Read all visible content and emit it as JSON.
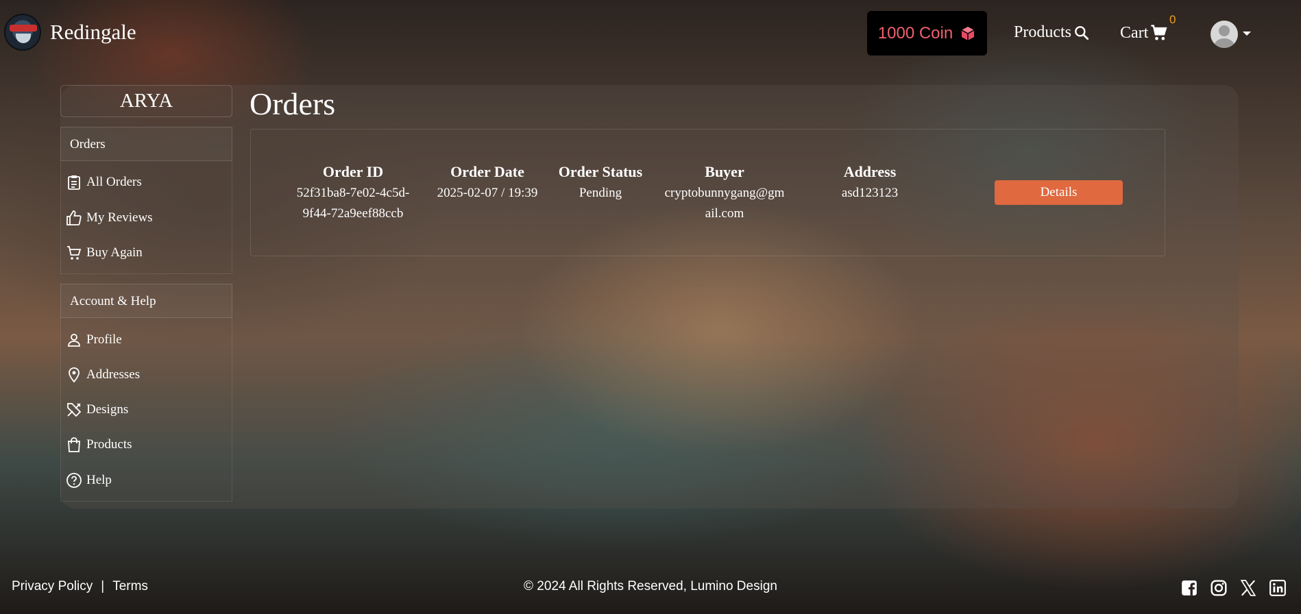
{
  "navbar": {
    "brand": "Redingale",
    "coin_label": "1000 Coin",
    "products_label": "Products",
    "cart_label": "Cart",
    "cart_count": "0"
  },
  "sidebar": {
    "user_name": "ARYA",
    "orders_section": "Orders",
    "orders_items": [
      {
        "label": "All Orders",
        "icon": "clipboard-icon"
      },
      {
        "label": "My Reviews",
        "icon": "thumbs-up-icon"
      },
      {
        "label": "Buy Again",
        "icon": "cart-icon"
      }
    ],
    "account_section": "Account & Help",
    "account_items": [
      {
        "label": "Profile",
        "icon": "person-icon"
      },
      {
        "label": "Addresses",
        "icon": "location-pin-icon"
      },
      {
        "label": "Designs",
        "icon": "design-tools-icon"
      },
      {
        "label": "Products",
        "icon": "shopping-bag-icon"
      },
      {
        "label": "Help",
        "icon": "help-circle-icon"
      }
    ]
  },
  "main": {
    "title": "Orders",
    "columns": [
      "Order ID",
      "Order Date",
      "Order Status",
      "Buyer",
      "Address"
    ],
    "order": {
      "id_line1": "52f31ba8-7e02-4c5d-",
      "id_line2": "9f44-72a9eef88ccb",
      "date": "2025-02-07 / 19:39",
      "status": "Pending",
      "buyer_line1": "cryptobunnygang@gm",
      "buyer_line2": "ail.com",
      "address": "asd123123"
    },
    "details_label": "Details"
  },
  "footer": {
    "privacy": "Privacy Policy",
    "separator": "|",
    "terms": "Terms",
    "copyright": "© 2024 All Rights Reserved, Lumino Design",
    "socials": [
      "facebook-icon",
      "instagram-icon",
      "x-icon",
      "linkedin-icon"
    ]
  },
  "colors": {
    "accent": "#e0693f",
    "coin_text": "#f06070",
    "cart_count": "#f0a020"
  }
}
